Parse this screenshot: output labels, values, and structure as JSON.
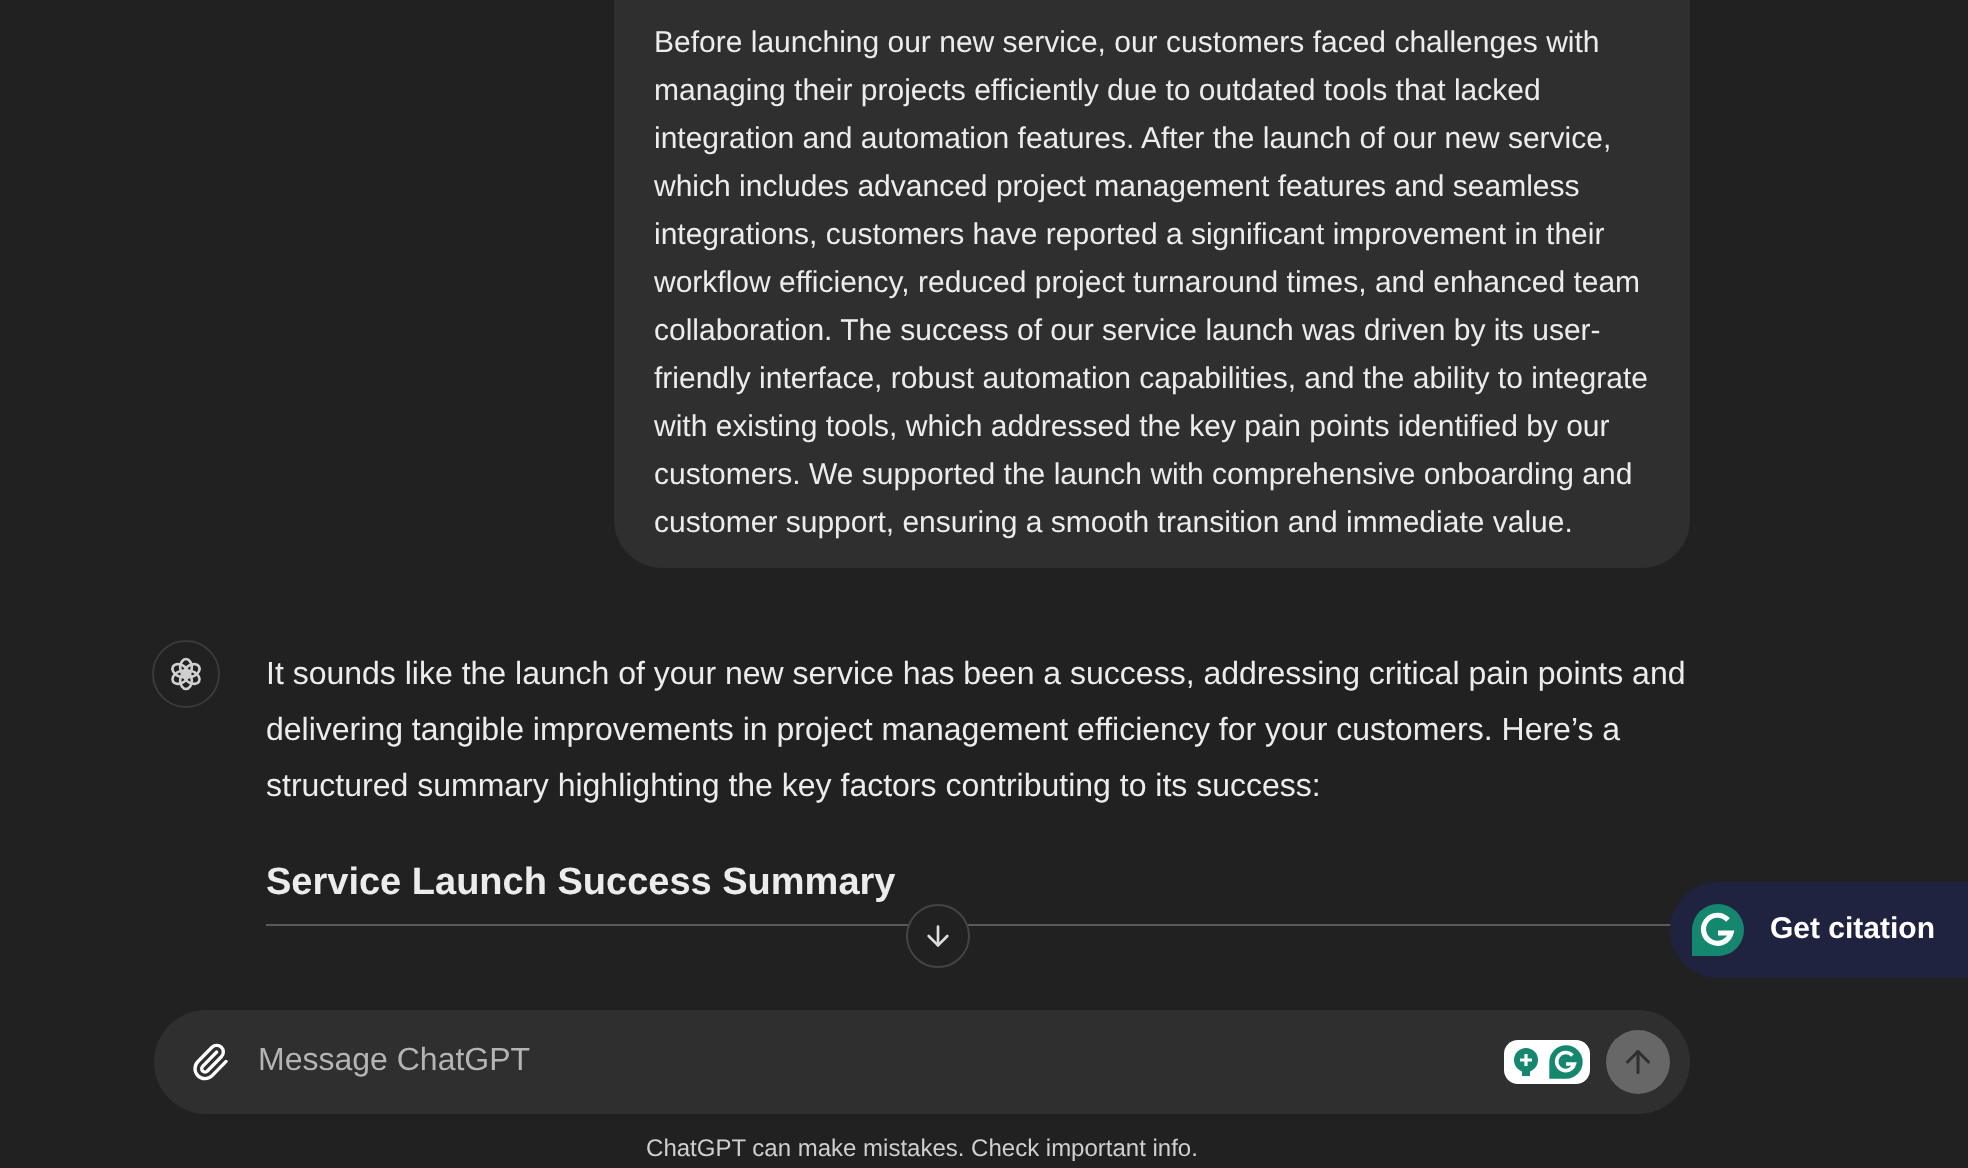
{
  "user_message": "Before launching our new service, our customers faced challenges with managing their projects efficiently due to outdated tools that lacked integration and automation features. After the launch of our new service, which includes advanced project management features and seamless integrations, customers have reported a significant improvement in their workflow efficiency, reduced project turnaround times, and enhanced team collaboration. The success of our service launch was driven by its user-friendly interface, robust automation capabilities, and the ability to integrate with existing tools, which addressed the key pain points identified by our customers. We supported the launch with comprehensive onboarding and customer support, ensuring a smooth transition and immediate value.",
  "assistant_message": {
    "text": "It sounds like the launch of your new service has been a success, addressing critical pain points and delivering tangible improvements in project management efficiency for your customers. Here’s a structured summary highlighting the key factors contributing to its success:",
    "heading": "Service Launch Success Summary"
  },
  "citation_button": {
    "label": "Get citation"
  },
  "composer": {
    "placeholder": "Message ChatGPT"
  },
  "footer": "ChatGPT can make mistakes. Check important info."
}
